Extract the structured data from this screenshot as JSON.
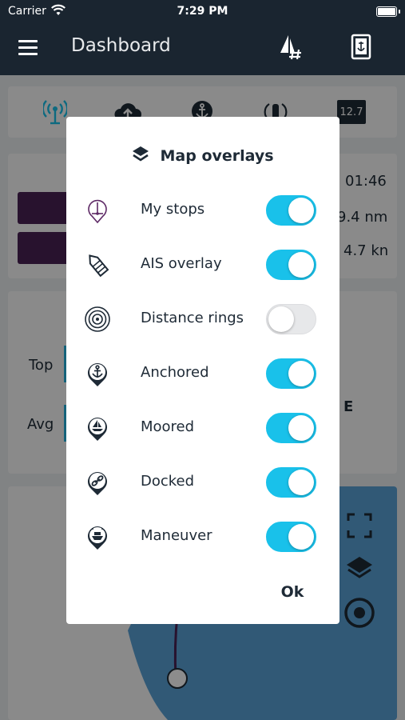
{
  "status": {
    "carrier": "Carrier",
    "time": "7:29 PM"
  },
  "header": {
    "title": "Dashboard",
    "icons": [
      "menu-icon",
      "sail-hash-icon",
      "logbook-icon"
    ]
  },
  "background": {
    "stats": {
      "time": "01:46",
      "distance": "9.4 nm",
      "speed": "4.7 kn"
    },
    "speed_rows": {
      "top_label": "Top",
      "avg_label": "Avg",
      "dir_letter": "E"
    },
    "tab_icons": [
      "signal-tower-icon",
      "cloud-upload-icon",
      "anchor-icon",
      "radio-icon",
      "calendar-icon"
    ],
    "calendar_value": "12.7"
  },
  "dialog": {
    "title": "Map overlays",
    "title_icon": "layers-icon",
    "items": [
      {
        "label": "My stops",
        "icon": "my-stops-icon",
        "on": true
      },
      {
        "label": "AIS overlay",
        "icon": "ais-overlay-icon",
        "on": true
      },
      {
        "label": "Distance rings",
        "icon": "distance-rings-icon",
        "on": false
      },
      {
        "label": "Anchored",
        "icon": "anchored-icon",
        "on": true
      },
      {
        "label": "Moored",
        "icon": "moored-icon",
        "on": true
      },
      {
        "label": "Docked",
        "icon": "docked-icon",
        "on": true
      },
      {
        "label": "Maneuver",
        "icon": "maneuver-icon",
        "on": true
      }
    ],
    "ok_label": "Ok"
  },
  "colors": {
    "accent": "#19c1ea",
    "header_bg": "#1a2530",
    "brand_purple": "#4a2255",
    "text_dark": "#1e2a36"
  }
}
